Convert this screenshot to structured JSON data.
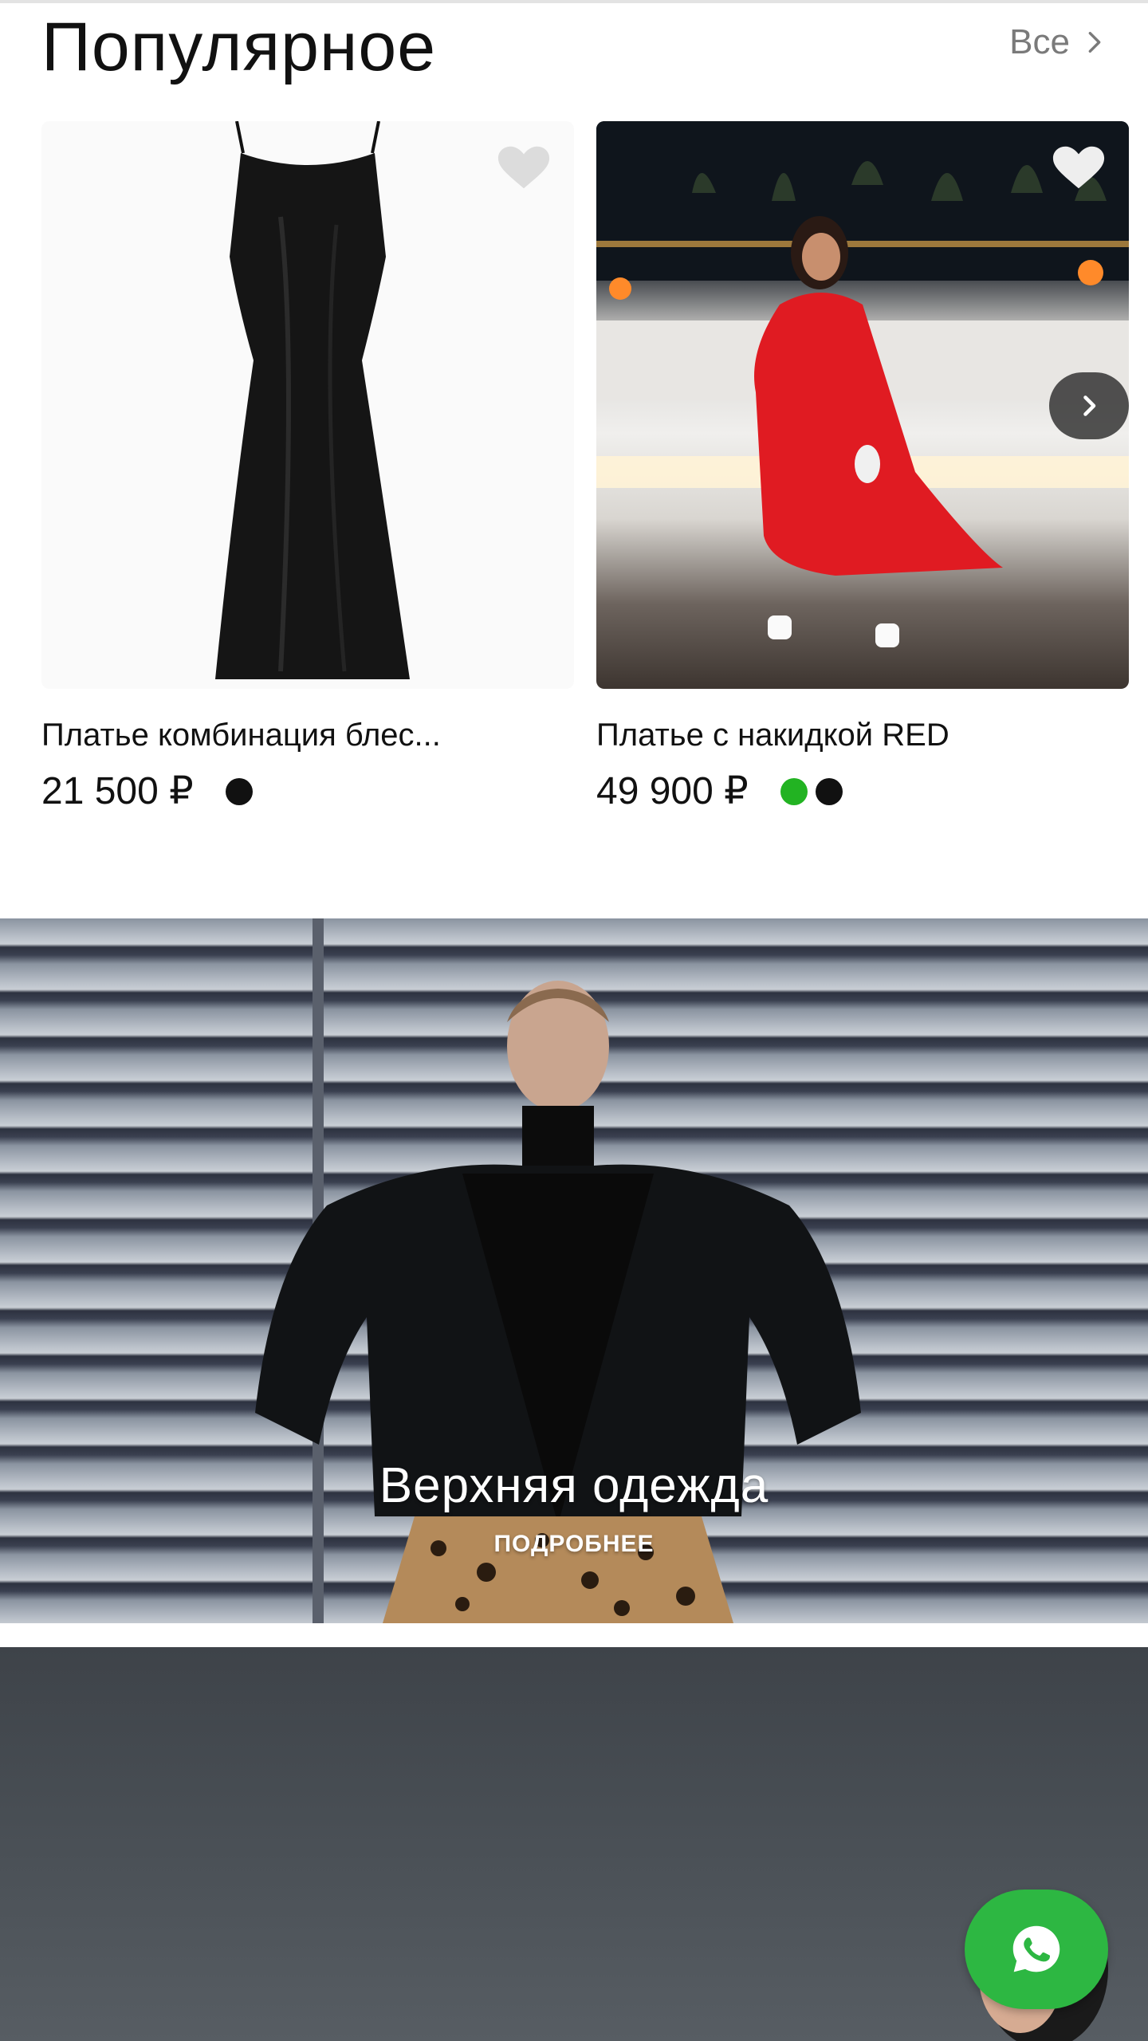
{
  "popular": {
    "title": "Популярное",
    "see_all_label": "Все"
  },
  "products": [
    {
      "name": "Платье комбинация блес...",
      "price": "21 500 ₽",
      "colors": [
        "#111111"
      ],
      "favorite_icon": "heart-icon"
    },
    {
      "name": "Платье с накидкой RED",
      "price": "49 900 ₽",
      "colors": [
        "#22b322",
        "#111111"
      ],
      "favorite_icon": "heart-icon",
      "carousel_icon": "chevron-right-icon"
    }
  ],
  "banners": [
    {
      "title": "Верхняя одежда",
      "link_label": "ПОДРОБНЕЕ"
    }
  ],
  "fab": {
    "icon": "whatsapp-icon",
    "color": "#2db742"
  }
}
